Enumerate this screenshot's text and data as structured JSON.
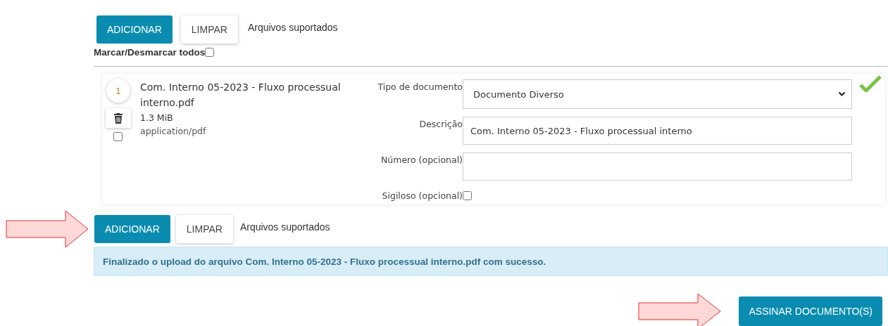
{
  "top_toolbar": {
    "highlighted": false,
    "buttons": [
      {
        "label": "ADICIONAR",
        "kind": "primary"
      },
      {
        "label": "LIMPAR",
        "kind": "default"
      }
    ],
    "link": "Arquivos suportados"
  },
  "select_all": {
    "label": "Marcar/Desmarcar todos",
    "checked": false
  },
  "files": [
    {
      "index": "1",
      "name": "Com. Interno 05-2023 - Fluxo processual interno.pdf",
      "size": "1.3 MiB",
      "type": "application/pdf",
      "checked": false,
      "valid": true,
      "fields": [
        {
          "kind": "select",
          "label": "Tipo de documento",
          "value": "Documento Diverso"
        },
        {
          "kind": "text",
          "label": "Descrição",
          "value": "Com. Interno 05-2023 - Fluxo processual interno"
        },
        {
          "kind": "text",
          "label": "Número (opcional)"
        },
        {
          "kind": "checkbox",
          "label": "Sigiloso (opcional)",
          "checked": false
        }
      ]
    }
  ],
  "bottom_toolbar": {
    "highlighted": true,
    "buttons": [
      {
        "label": "ADICIONAR",
        "kind": "primary"
      },
      {
        "label": "LIMPAR",
        "kind": "default"
      }
    ],
    "link": "Arquivos suportados"
  },
  "alert": "Finalizado o upload do arquivo Com. Interno 05-2023 - Fluxo processual interno.pdf com sucesso.",
  "sign_button": {
    "label": "ASSINAR DOCUMENTO(S)",
    "highlighted": true
  }
}
